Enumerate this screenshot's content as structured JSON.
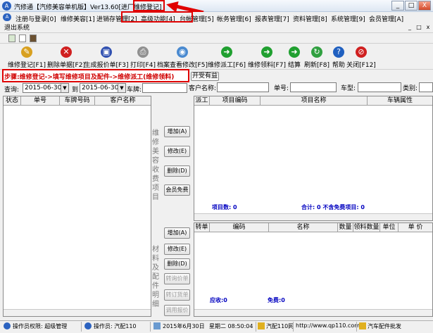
{
  "window": {
    "title": "汽修通【汽修美容单机版】Ver13.60",
    "title_tag": "[进厂维修登记]",
    "minimize": "_",
    "maximize": "□",
    "close": "X"
  },
  "menubar": [
    {
      "label": "注册与登录[0]"
    },
    {
      "label": "维修美容[1]"
    },
    {
      "label": "进销存管理[2]"
    },
    {
      "label": "高级功能[4]"
    },
    {
      "label": "台帐管理[5]"
    },
    {
      "label": "帐务管理[6]"
    },
    {
      "label": "报表管理[7]"
    },
    {
      "label": "资料管理[8]"
    },
    {
      "label": "系统管理[9]"
    },
    {
      "label": "会员管理[A]"
    }
  ],
  "submenu": {
    "exit": "退出系统",
    "min": "_",
    "restore": "□",
    "close": "x"
  },
  "toolbar": [
    {
      "label": "维修登记[F1]",
      "icon": "register-icon",
      "color": "#d8a020",
      "glyph": "✎"
    },
    {
      "label": "删除单据[F2]",
      "icon": "delete-icon",
      "color": "#d02020",
      "glyph": "✕"
    },
    {
      "label": "生成报价单[F3]",
      "icon": "save-icon",
      "color": "#3050b0",
      "glyph": "▣"
    },
    {
      "label": "打印[F4]",
      "icon": "printer-icon",
      "color": "#909090",
      "glyph": "⎙"
    },
    {
      "label": "档案查看修改[F5]",
      "icon": "view-icon",
      "color": "#4a8ad0",
      "glyph": "◉"
    },
    {
      "label": "维修派工[F6]",
      "icon": "dispatch-icon",
      "color": "#20a030",
      "glyph": "➜"
    },
    {
      "label": "维修领料[F7]",
      "icon": "material-icon",
      "color": "#20a030",
      "glyph": "➜"
    },
    {
      "label": "结算",
      "icon": "settle-icon",
      "color": "#20a030",
      "glyph": "➜"
    },
    {
      "label": "刷新[F8]",
      "icon": "refresh-icon",
      "color": "#30a040",
      "glyph": "↻"
    },
    {
      "label": "帮助",
      "icon": "help-icon",
      "color": "#2060c0",
      "glyph": "?"
    },
    {
      "label": "关闭[F12]",
      "icon": "close-circle-icon",
      "color": "#d02020",
      "glyph": "⊘"
    }
  ],
  "steps": "步骤:维修登记->填写维修项目及配件->维修派工(维修领料)",
  "open_button": "开受有益",
  "filter": {
    "query_label": "查询:",
    "date_from": "2015-06-30",
    "to_label": "到",
    "date_to": "2015-06-30",
    "plate_label": "车牌:",
    "customer_label": "客户名称:",
    "number_label": "单号:",
    "cartype_label": "车型:",
    "category_label": "类别:"
  },
  "left_table": {
    "columns": [
      "状态",
      "单号",
      "车牌号码",
      "客户名称"
    ]
  },
  "service_section": {
    "vertical_label": "维修美容收费项目",
    "buttons": [
      "增加(A)",
      "修改(E)",
      "删除(D)",
      "会员免费"
    ],
    "columns": [
      "派工",
      "项目编码",
      "项目名称",
      "车辆属性"
    ],
    "item_count": "项目数: 0",
    "total": "合计: 0 不含免费项目: 0"
  },
  "parts_section": {
    "vertical_label": "材料及配件明细",
    "buttons": [
      "增加(A)",
      "修改(E)",
      "删除(D)",
      "转询价单",
      "转订货单",
      "调用报价"
    ],
    "columns": [
      "转单",
      "编码",
      "名称",
      "数量",
      "领料数量",
      "单位",
      "单 价"
    ],
    "receivable": "应收:0",
    "free": "免费:0"
  },
  "statusbar": {
    "permission": "操作员权限: 超级管理",
    "operator": "操作员: 汽配110",
    "date": "2015年6月30日",
    "weekday_time": "星期二 08:50:04",
    "site": "汽配110网",
    "url": "http://www.qp110.com",
    "ad": "汽车配件批发"
  },
  "colors": {
    "annotation": "#e00000",
    "link_blue": "#0000c0"
  }
}
